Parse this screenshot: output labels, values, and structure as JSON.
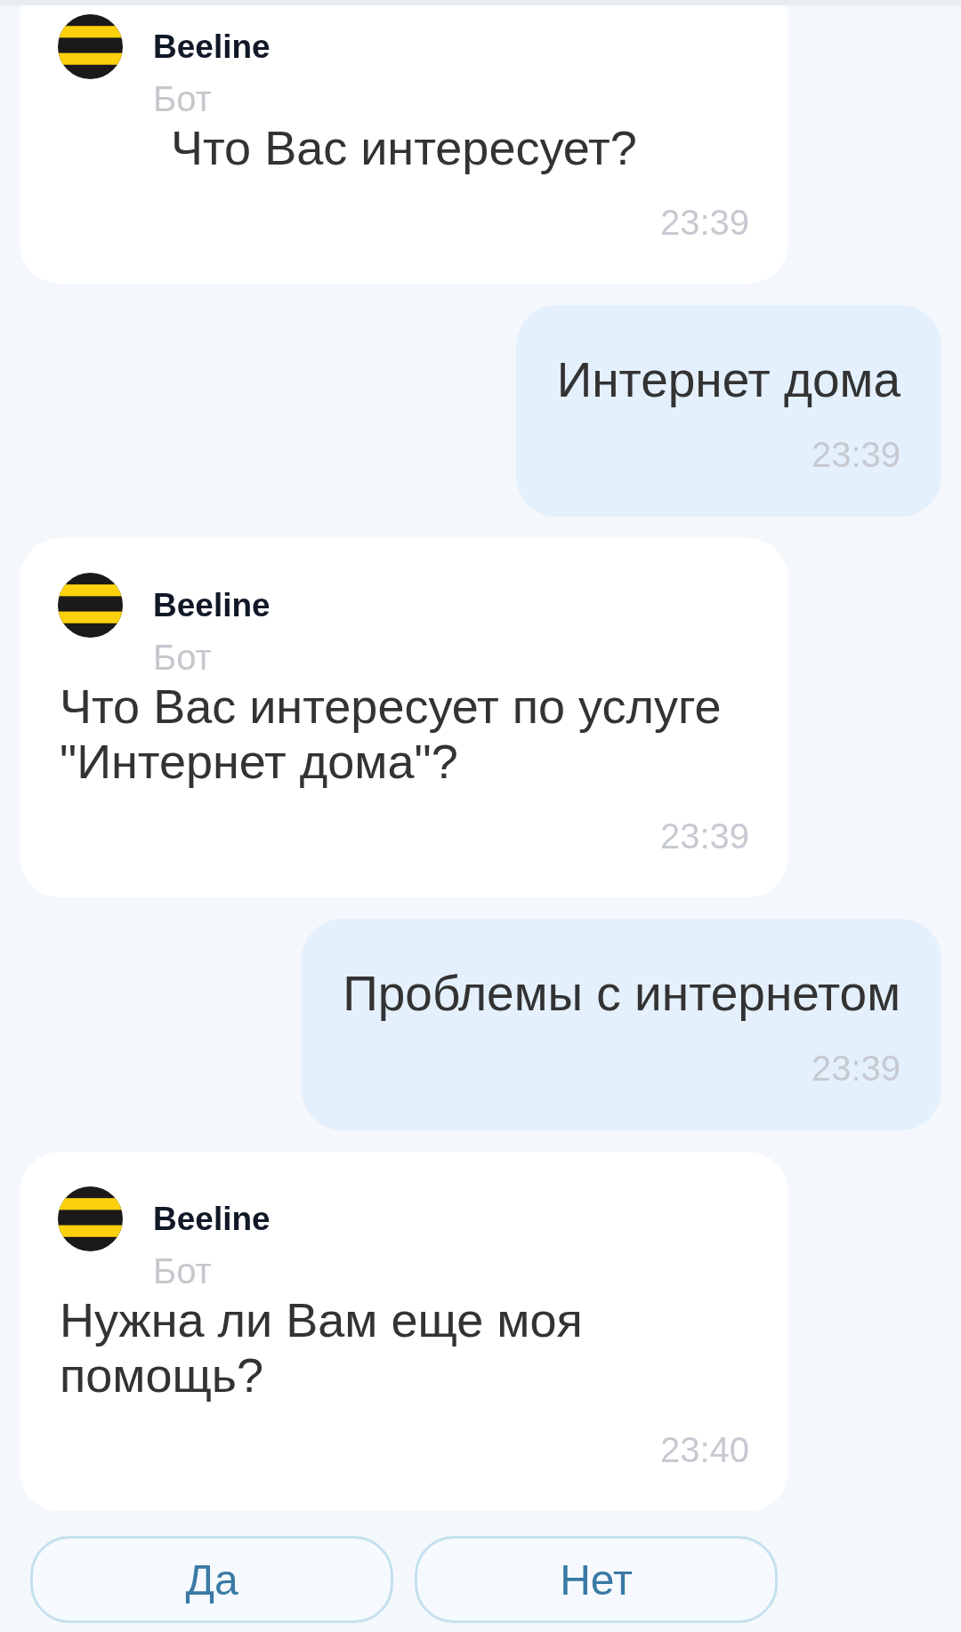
{
  "messages": [
    {
      "kind": "bot",
      "sender": "Beeline",
      "role": "Бот",
      "text": "Что Вас интересует?",
      "time": "23:39",
      "indented": true
    },
    {
      "kind": "user",
      "text": "Интернет дома",
      "time": "23:39"
    },
    {
      "kind": "bot",
      "sender": "Beeline",
      "role": "Бот",
      "text": "Что Вас интересует по услуге \"Интернет дома\"?",
      "time": "23:39",
      "indented": false
    },
    {
      "kind": "user",
      "text": "Проблемы с интернетом",
      "time": "23:39"
    },
    {
      "kind": "bot",
      "sender": "Beeline",
      "role": "Бот",
      "text": "Нужна ли Вам еще моя помощь?",
      "time": "23:40",
      "indented": false
    }
  ],
  "quick_replies": [
    "Да",
    "Нет"
  ]
}
